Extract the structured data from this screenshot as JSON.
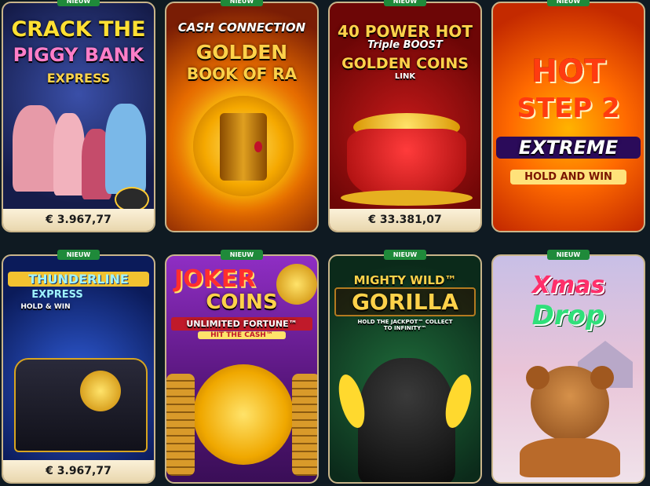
{
  "badge_label": "NIEUW",
  "tiles": [
    {
      "name": "crack-the-piggy-bank-express",
      "title_lines": [
        "CRACK THE",
        "PIGGY BANK",
        "EXPRESS"
      ],
      "price": "€ 3.967,77",
      "has_badge": true
    },
    {
      "name": "golden-book-of-ra",
      "title_lines": [
        "CASH CONNECTION",
        "GOLDEN",
        "BOOK OF RA"
      ],
      "price": "",
      "has_badge": true
    },
    {
      "name": "40-power-hot-golden-coins",
      "title_lines": [
        "40 POWER HOT",
        "Triple BOOST",
        "GOLDEN COINS",
        "LINK"
      ],
      "price": "€ 33.381,07",
      "has_badge": true
    },
    {
      "name": "hot-step-2-extreme",
      "title_lines": [
        "HOT",
        "STEP 2",
        "EXTREME",
        "HOLD AND WIN"
      ],
      "price": "",
      "has_badge": true
    },
    {
      "name": "thunderline-express",
      "title_lines": [
        "THUNDERLINE",
        "EXPRESS",
        "HOLD & WIN"
      ],
      "price": "€ 3.967,77",
      "has_badge": true
    },
    {
      "name": "joker-coins",
      "title_lines": [
        "JOKER",
        "COINS",
        "UNLIMITED FORTUNE™",
        "HIT THE CASH™"
      ],
      "price": "",
      "has_badge": true
    },
    {
      "name": "mighty-wild-gorilla",
      "title_lines": [
        "MIGHTY WILD™",
        "GORILLA",
        "HOLD THE JACKPOT™ COLLECT TO INFINITY™"
      ],
      "price": "",
      "has_badge": true
    },
    {
      "name": "xmas-drop",
      "title_lines": [
        "Xmas",
        "Drop"
      ],
      "price": "",
      "has_badge": true
    }
  ]
}
